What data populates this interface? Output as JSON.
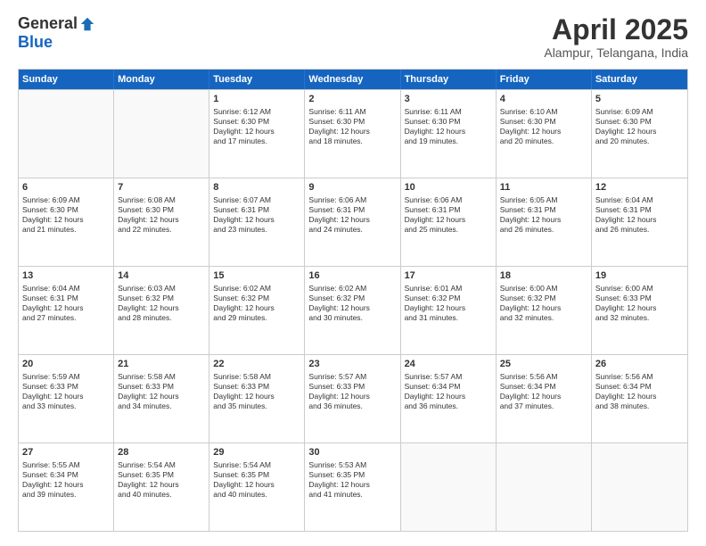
{
  "logo": {
    "general": "General",
    "blue": "Blue"
  },
  "title": "April 2025",
  "subtitle": "Alampur, Telangana, India",
  "header_days": [
    "Sunday",
    "Monday",
    "Tuesday",
    "Wednesday",
    "Thursday",
    "Friday",
    "Saturday"
  ],
  "weeks": [
    [
      {
        "day": "",
        "info": ""
      },
      {
        "day": "",
        "info": ""
      },
      {
        "day": "1",
        "info": "Sunrise: 6:12 AM\nSunset: 6:30 PM\nDaylight: 12 hours\nand 17 minutes."
      },
      {
        "day": "2",
        "info": "Sunrise: 6:11 AM\nSunset: 6:30 PM\nDaylight: 12 hours\nand 18 minutes."
      },
      {
        "day": "3",
        "info": "Sunrise: 6:11 AM\nSunset: 6:30 PM\nDaylight: 12 hours\nand 19 minutes."
      },
      {
        "day": "4",
        "info": "Sunrise: 6:10 AM\nSunset: 6:30 PM\nDaylight: 12 hours\nand 20 minutes."
      },
      {
        "day": "5",
        "info": "Sunrise: 6:09 AM\nSunset: 6:30 PM\nDaylight: 12 hours\nand 20 minutes."
      }
    ],
    [
      {
        "day": "6",
        "info": "Sunrise: 6:09 AM\nSunset: 6:30 PM\nDaylight: 12 hours\nand 21 minutes."
      },
      {
        "day": "7",
        "info": "Sunrise: 6:08 AM\nSunset: 6:30 PM\nDaylight: 12 hours\nand 22 minutes."
      },
      {
        "day": "8",
        "info": "Sunrise: 6:07 AM\nSunset: 6:31 PM\nDaylight: 12 hours\nand 23 minutes."
      },
      {
        "day": "9",
        "info": "Sunrise: 6:06 AM\nSunset: 6:31 PM\nDaylight: 12 hours\nand 24 minutes."
      },
      {
        "day": "10",
        "info": "Sunrise: 6:06 AM\nSunset: 6:31 PM\nDaylight: 12 hours\nand 25 minutes."
      },
      {
        "day": "11",
        "info": "Sunrise: 6:05 AM\nSunset: 6:31 PM\nDaylight: 12 hours\nand 26 minutes."
      },
      {
        "day": "12",
        "info": "Sunrise: 6:04 AM\nSunset: 6:31 PM\nDaylight: 12 hours\nand 26 minutes."
      }
    ],
    [
      {
        "day": "13",
        "info": "Sunrise: 6:04 AM\nSunset: 6:31 PM\nDaylight: 12 hours\nand 27 minutes."
      },
      {
        "day": "14",
        "info": "Sunrise: 6:03 AM\nSunset: 6:32 PM\nDaylight: 12 hours\nand 28 minutes."
      },
      {
        "day": "15",
        "info": "Sunrise: 6:02 AM\nSunset: 6:32 PM\nDaylight: 12 hours\nand 29 minutes."
      },
      {
        "day": "16",
        "info": "Sunrise: 6:02 AM\nSunset: 6:32 PM\nDaylight: 12 hours\nand 30 minutes."
      },
      {
        "day": "17",
        "info": "Sunrise: 6:01 AM\nSunset: 6:32 PM\nDaylight: 12 hours\nand 31 minutes."
      },
      {
        "day": "18",
        "info": "Sunrise: 6:00 AM\nSunset: 6:32 PM\nDaylight: 12 hours\nand 32 minutes."
      },
      {
        "day": "19",
        "info": "Sunrise: 6:00 AM\nSunset: 6:33 PM\nDaylight: 12 hours\nand 32 minutes."
      }
    ],
    [
      {
        "day": "20",
        "info": "Sunrise: 5:59 AM\nSunset: 6:33 PM\nDaylight: 12 hours\nand 33 minutes."
      },
      {
        "day": "21",
        "info": "Sunrise: 5:58 AM\nSunset: 6:33 PM\nDaylight: 12 hours\nand 34 minutes."
      },
      {
        "day": "22",
        "info": "Sunrise: 5:58 AM\nSunset: 6:33 PM\nDaylight: 12 hours\nand 35 minutes."
      },
      {
        "day": "23",
        "info": "Sunrise: 5:57 AM\nSunset: 6:33 PM\nDaylight: 12 hours\nand 36 minutes."
      },
      {
        "day": "24",
        "info": "Sunrise: 5:57 AM\nSunset: 6:34 PM\nDaylight: 12 hours\nand 36 minutes."
      },
      {
        "day": "25",
        "info": "Sunrise: 5:56 AM\nSunset: 6:34 PM\nDaylight: 12 hours\nand 37 minutes."
      },
      {
        "day": "26",
        "info": "Sunrise: 5:56 AM\nSunset: 6:34 PM\nDaylight: 12 hours\nand 38 minutes."
      }
    ],
    [
      {
        "day": "27",
        "info": "Sunrise: 5:55 AM\nSunset: 6:34 PM\nDaylight: 12 hours\nand 39 minutes."
      },
      {
        "day": "28",
        "info": "Sunrise: 5:54 AM\nSunset: 6:35 PM\nDaylight: 12 hours\nand 40 minutes."
      },
      {
        "day": "29",
        "info": "Sunrise: 5:54 AM\nSunset: 6:35 PM\nDaylight: 12 hours\nand 40 minutes."
      },
      {
        "day": "30",
        "info": "Sunrise: 5:53 AM\nSunset: 6:35 PM\nDaylight: 12 hours\nand 41 minutes."
      },
      {
        "day": "",
        "info": ""
      },
      {
        "day": "",
        "info": ""
      },
      {
        "day": "",
        "info": ""
      }
    ]
  ]
}
